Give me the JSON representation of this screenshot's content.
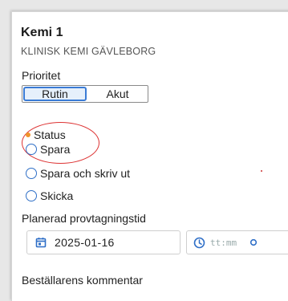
{
  "form": {
    "title": "Kemi 1",
    "subtitle": "KLINISK KEMI GÄVLEBORG",
    "priority_label": "Prioritet",
    "priority_options": [
      "Rutin",
      "Akut"
    ],
    "priority_selected": "Rutin",
    "status_label": "Status",
    "status_options": [
      "Spara",
      "Spara och skriv ut",
      "Skicka"
    ],
    "planned_label": "Planerad provtagningstid",
    "date_value": "2025-01-16",
    "time_placeholder": "tt:mm",
    "comment_label": "Beställarens kommentar"
  },
  "colors": {
    "accent": "#2f6fc7",
    "status_dot": "#f0932b",
    "annotation": "#dd3333"
  }
}
